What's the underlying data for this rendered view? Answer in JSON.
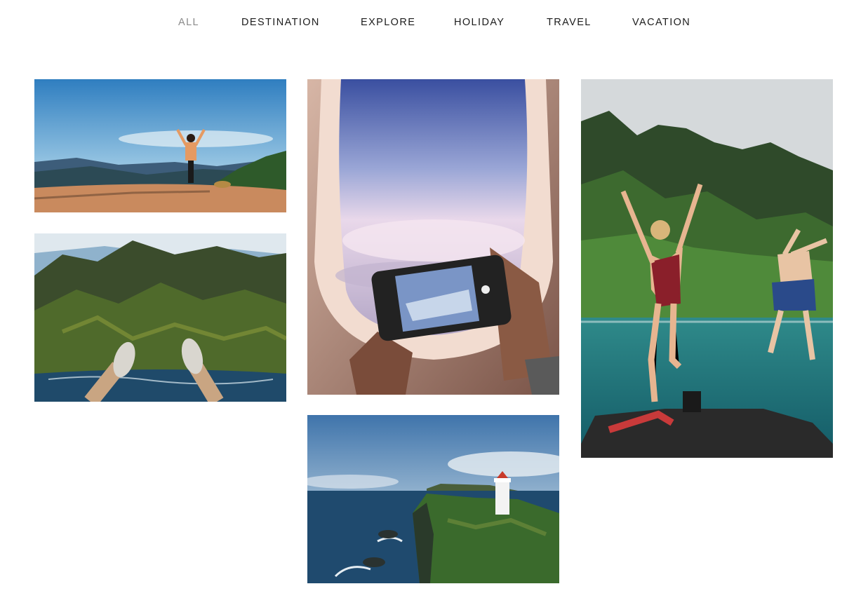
{
  "filters": [
    {
      "label": "ALL",
      "active": true
    },
    {
      "label": "DESTINATION",
      "active": false
    },
    {
      "label": "EXPLORE",
      "active": false
    },
    {
      "label": "HOLIDAY",
      "active": false
    },
    {
      "label": "TRAVEL",
      "active": false
    },
    {
      "label": "VACATION",
      "active": false
    }
  ],
  "gallery": [
    {
      "subject": "person with raised arms on cliff overlooking mountains"
    },
    {
      "subject": "feet dangling over green sea cliffs"
    },
    {
      "subject": "phone photographing clouds through airplane window"
    },
    {
      "subject": "white lighthouse on green coastal cliff"
    },
    {
      "subject": "two people jumping from boat into turquoise water"
    }
  ]
}
